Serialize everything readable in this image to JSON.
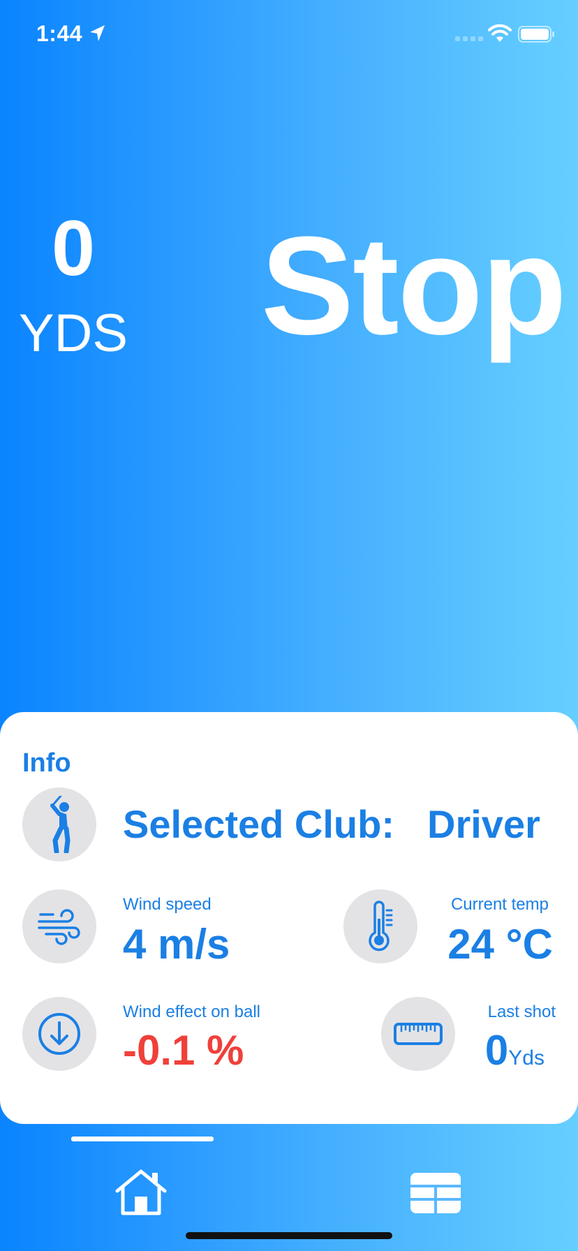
{
  "status_bar": {
    "time": "1:44"
  },
  "distance": {
    "value": "0",
    "unit": "YDS"
  },
  "action_button": {
    "label": "Stop"
  },
  "info": {
    "title": "Info",
    "club": {
      "label": "Selected Club:",
      "value": "Driver",
      "icon": "golfer-icon"
    },
    "wind_speed": {
      "label": "Wind speed",
      "value": "4 m/s",
      "icon": "wind-icon"
    },
    "current_temp": {
      "label": "Current temp",
      "value": "24 °C",
      "icon": "thermometer-icon"
    },
    "wind_effect": {
      "label": "Wind effect on ball",
      "value": "-0.1 %",
      "icon": "arrow-down-circle-icon",
      "color": "#f0403a"
    },
    "last_shot": {
      "label": "Last shot",
      "value": "0",
      "unit": "Yds",
      "icon": "ruler-icon"
    }
  },
  "tabs": [
    {
      "icon": "home-icon",
      "selected": true
    },
    {
      "icon": "table-icon",
      "selected": false
    }
  ],
  "colors": {
    "gradient_start": "#0a84ff",
    "gradient_end": "#66cfff",
    "accent_blue": "#1b7fe4",
    "negative_red": "#f0403a",
    "icon_circle": "#e3e3e6"
  }
}
